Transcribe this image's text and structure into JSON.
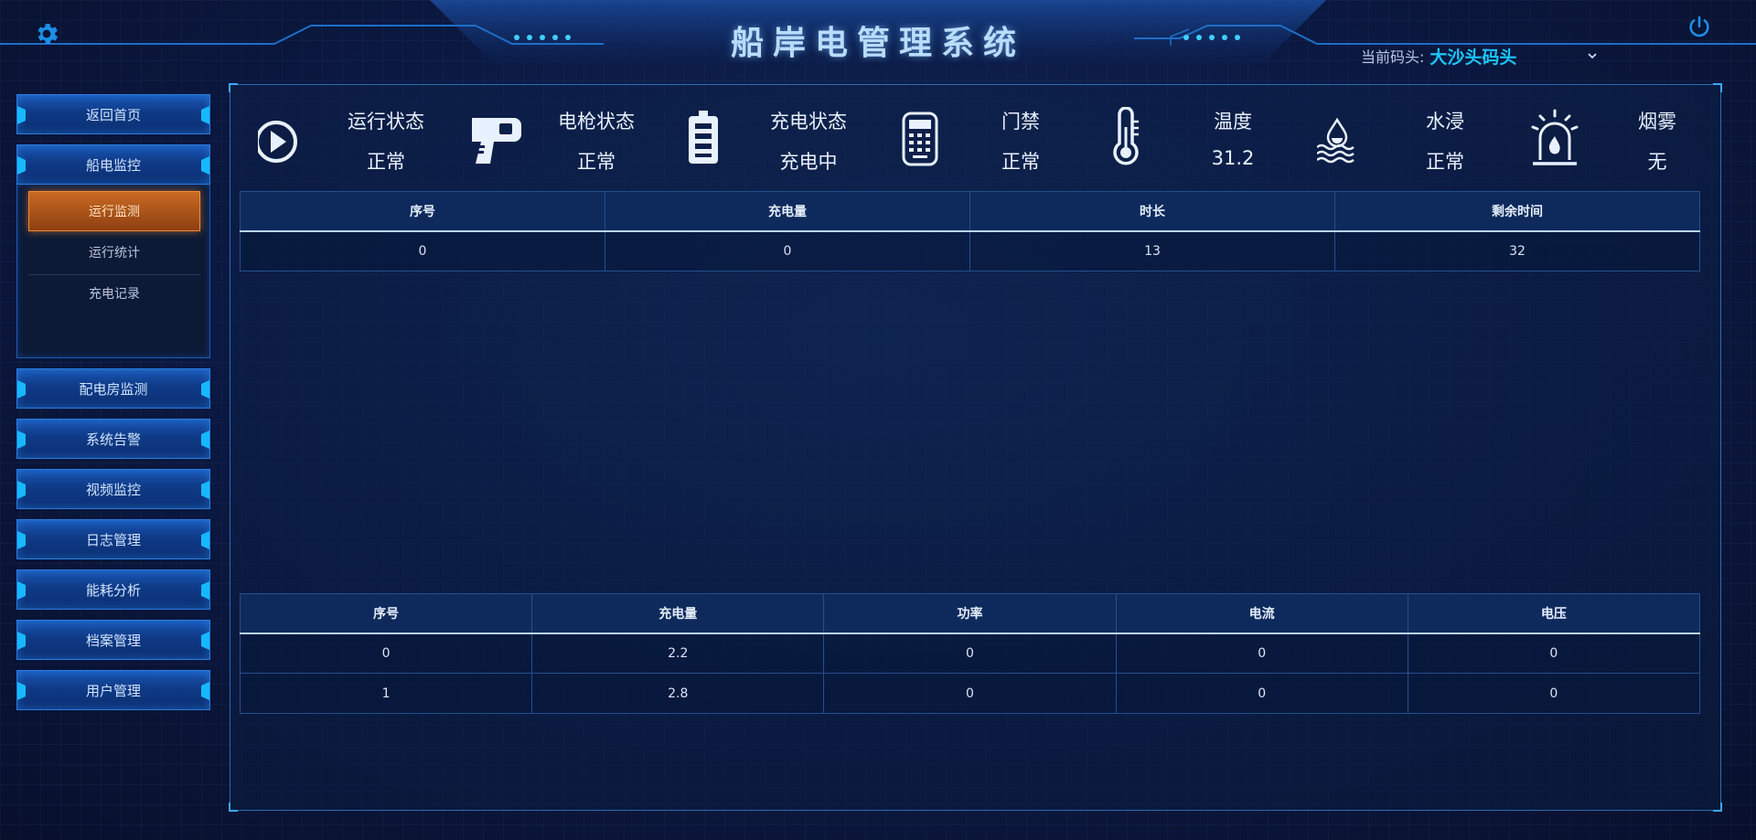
{
  "header": {
    "title": "船岸电管理系统",
    "pier_label": "当前码头:",
    "pier_value": "大沙头码头",
    "icons": {
      "settings": "gear-icon",
      "power": "power-icon",
      "dropdown": "chevron-down-icon"
    }
  },
  "sidebar": {
    "items": [
      {
        "label": "返回首页"
      },
      {
        "label": "船电监控"
      },
      {
        "label": "配电房监测"
      },
      {
        "label": "系统告警"
      },
      {
        "label": "视频监控"
      },
      {
        "label": "日志管理"
      },
      {
        "label": "能耗分析"
      },
      {
        "label": "档案管理"
      },
      {
        "label": "用户管理"
      }
    ],
    "submenu": [
      {
        "label": "运行监测",
        "active": true
      },
      {
        "label": "运行统计"
      },
      {
        "label": "充电记录"
      }
    ]
  },
  "status": [
    {
      "icon": "play-circle-icon",
      "label": "运行状态",
      "value": "正常"
    },
    {
      "icon": "charging-gun-icon",
      "label": "电枪状态",
      "value": "正常"
    },
    {
      "icon": "battery-icon",
      "label": "充电状态",
      "value": "充电中"
    },
    {
      "icon": "access-control-icon",
      "label": "门禁",
      "value": "正常"
    },
    {
      "icon": "thermometer-icon",
      "label": "温度",
      "value": "31.2"
    },
    {
      "icon": "water-immersion-icon",
      "label": "水浸",
      "value": "正常"
    },
    {
      "icon": "smoke-alarm-icon",
      "label": "烟雾",
      "value": "无"
    }
  ],
  "table1": {
    "columns": [
      "序号",
      "充电量",
      "时长",
      "剩余时间"
    ],
    "rows": [
      [
        "0",
        "0",
        "13",
        "32"
      ]
    ]
  },
  "table2": {
    "columns": [
      "序号",
      "充电量",
      "功率",
      "电流",
      "电压"
    ],
    "rows": [
      [
        "0",
        "2.2",
        "0",
        "0",
        "0"
      ],
      [
        "1",
        "2.8",
        "0",
        "0",
        "0"
      ]
    ]
  },
  "colors": {
    "accent": "#19c7ff",
    "active": "#c86a22",
    "panel_border": "#2b6bb4"
  }
}
